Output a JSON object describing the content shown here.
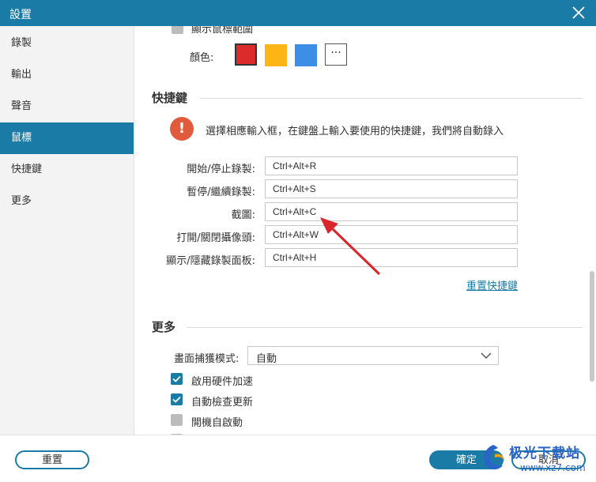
{
  "window": {
    "title": "設置"
  },
  "sidebar": {
    "items": [
      {
        "label": "錄製"
      },
      {
        "label": "輸出"
      },
      {
        "label": "聲音"
      },
      {
        "label": "鼠標"
      },
      {
        "label": "快捷鍵"
      },
      {
        "label": "更多"
      }
    ],
    "active_index": 3
  },
  "mouse": {
    "show_cursor_area_label": "顯示鼠標範圍",
    "color_label": "顏色:",
    "colors": [
      "#dc2b2b",
      "#fdb515",
      "#3d8fe6"
    ],
    "more_colors_glyph": "···"
  },
  "shortcuts": {
    "section_title": "快捷鍵",
    "info_glyph": "!",
    "info_text": "選擇相應輸入框，在鍵盤上輸入要使用的快捷鍵，我們將自動錄入",
    "rows": [
      {
        "label": "開始/停止錄製:",
        "value": "Ctrl+Alt+R"
      },
      {
        "label": "暫停/繼續錄製:",
        "value": "Ctrl+Alt+S"
      },
      {
        "label": "截圖:",
        "value": "Ctrl+Alt+C"
      },
      {
        "label": "打開/關閉攝像頭:",
        "value": "Ctrl+Alt+W"
      },
      {
        "label": "顯示/隱藏錄製面板:",
        "value": "Ctrl+Alt+H"
      }
    ],
    "reset_link": "重置快捷鍵"
  },
  "more": {
    "section_title": "更多",
    "capture_mode_label": "畫面捕獲模式:",
    "capture_mode_value": "自動",
    "options": [
      {
        "label": "啟用硬件加速",
        "checked": true
      },
      {
        "label": "自動檢查更新",
        "checked": true
      },
      {
        "label": "開機自啟動",
        "checked": false
      }
    ]
  },
  "footer": {
    "reset_label": "重置",
    "ok_label": "確定",
    "cancel_label": "取消"
  },
  "watermark": {
    "text": "极光下载站",
    "url": "www.xz7.com"
  },
  "colors": {
    "accent": "#1a7ba6",
    "warning": "#e25a3c",
    "annotation_arrow": "#d9262c"
  }
}
